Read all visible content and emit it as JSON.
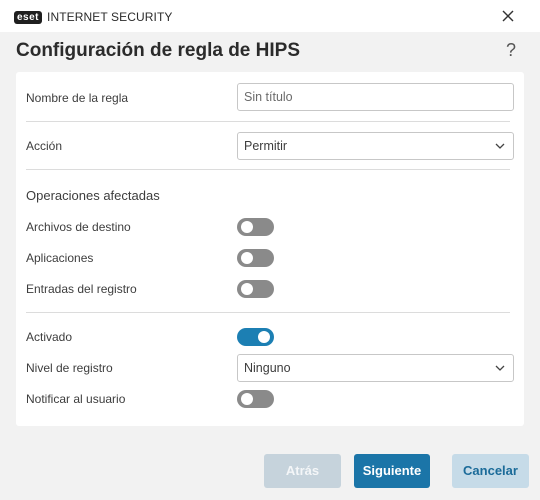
{
  "window": {
    "brand_badge": "eset",
    "product_name": "INTERNET SECURITY"
  },
  "header": {
    "title": "Configuración de regla de HIPS",
    "help_label": "?"
  },
  "form": {
    "rule_name_label": "Nombre de la regla",
    "rule_name_placeholder": "Sin título",
    "action_label": "Acción",
    "action_value": "Permitir",
    "affected_ops_label": "Operaciones afectadas",
    "target_files_label": "Archivos de destino",
    "target_files_enabled": false,
    "applications_label": "Aplicaciones",
    "applications_enabled": false,
    "registry_entries_label": "Entradas del registro",
    "registry_entries_enabled": false,
    "enabled_label": "Activado",
    "enabled_value": true,
    "log_level_label": "Nivel de registro",
    "log_level_value": "Ninguno",
    "notify_user_label": "Notificar al usuario",
    "notify_user_enabled": false
  },
  "footer": {
    "back_label": "Atrás",
    "next_label": "Siguiente",
    "cancel_label": "Cancelar"
  },
  "colors": {
    "accent": "#1c7fb3",
    "toggle_off": "#8a8a8a",
    "primary_button": "#1b75a8"
  }
}
